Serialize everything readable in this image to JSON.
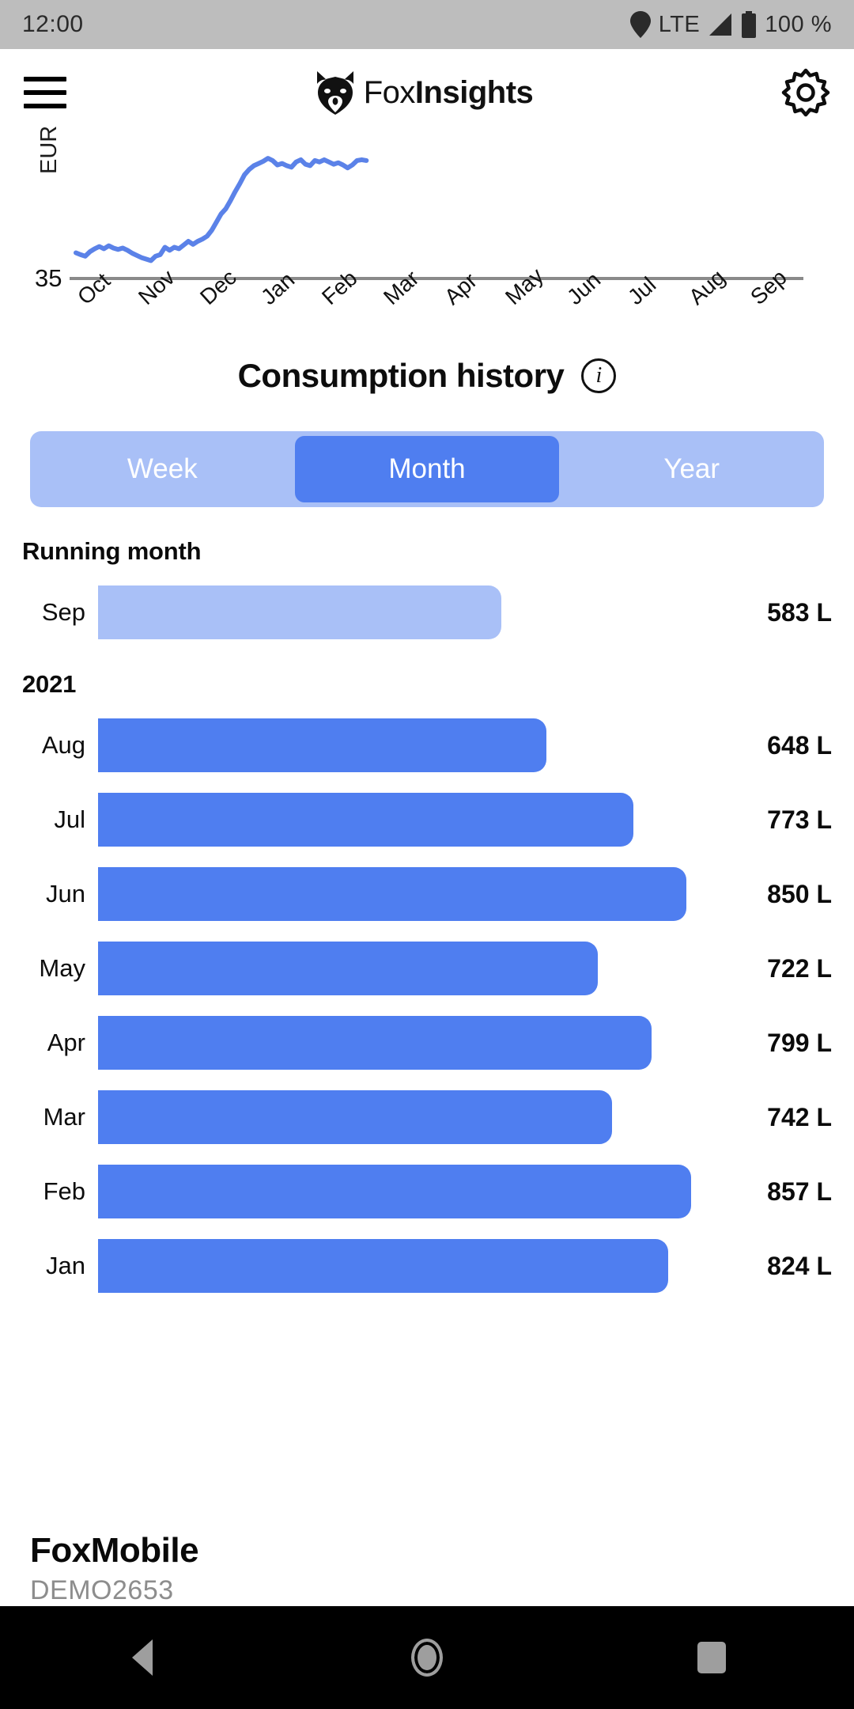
{
  "status_bar": {
    "time": "12:00",
    "network": "LTE",
    "battery_percent": "100 %",
    "icons": [
      "location-icon",
      "signal-icon",
      "battery-icon"
    ]
  },
  "header": {
    "menu_icon": "hamburger-menu-icon",
    "brand_prefix": "Fox",
    "brand_suffix": "Insights",
    "logo_icon": "fox-head-logo",
    "settings_icon": "gear-icon"
  },
  "price_chart": {
    "ylabel": "EUR",
    "ymin_label": "35",
    "line_color": "#5b82e8",
    "axis_color": "#8a8a8a",
    "xticks": [
      "Oct",
      "Nov",
      "Dec",
      "Jan",
      "Feb",
      "Mar",
      "Apr",
      "May",
      "Jun",
      "Jul",
      "Aug",
      "Sep"
    ]
  },
  "chart_data": [
    {
      "type": "line",
      "title": "EUR price history",
      "xlabel": "",
      "ylabel": "EUR",
      "ylim": [
        35,
        70
      ],
      "grid": false,
      "legend": "none",
      "xtick_labels": [
        "Oct",
        "Nov",
        "Dec",
        "Jan",
        "Feb",
        "Mar",
        "Apr",
        "May",
        "Jun",
        "Jul",
        "Aug",
        "Sep"
      ],
      "series": [
        {
          "name": "EUR",
          "color": "#5b82e8",
          "values": [
            41.5,
            41.0,
            40.6,
            41.8,
            42.6,
            43.2,
            42.6,
            43.4,
            42.8,
            42.4,
            42.8,
            42.2,
            41.4,
            40.8,
            40.2,
            39.8,
            39.4,
            40.6,
            41.0,
            43.0,
            42.2,
            43.0,
            42.6,
            43.6,
            44.6,
            43.8,
            44.6,
            45.2,
            46.0,
            47.6,
            49.8,
            52.0,
            53.4,
            55.6,
            58.0,
            60.2,
            62.6,
            64.0,
            65.0,
            65.6,
            66.2,
            67.0,
            66.4,
            65.2,
            65.6,
            65.0,
            64.6,
            66.0,
            66.6,
            65.4,
            65.0,
            66.4,
            66.0,
            66.6,
            66.0,
            65.4,
            65.8,
            65.2,
            64.4,
            65.2,
            66.4,
            66.6,
            66.4
          ]
        }
      ],
      "annotations": [
        "Data ends in February; remaining months Mar–Sep are empty"
      ]
    },
    {
      "type": "bar",
      "orientation": "horizontal",
      "title": "Consumption history",
      "unit": "L",
      "xlabel": "",
      "ylabel": "",
      "groups": [
        {
          "label": "Running month",
          "categories": [
            "Sep"
          ],
          "values": [
            583
          ],
          "color": "#a9c0f7"
        },
        {
          "label": "2021",
          "categories": [
            "Aug",
            "Jul",
            "Jun",
            "May",
            "Apr",
            "Mar",
            "Feb",
            "Jan"
          ],
          "values": [
            648,
            773,
            850,
            722,
            799,
            742,
            857,
            824
          ],
          "color": "#4f7ef0"
        }
      ],
      "max_value": 900
    }
  ],
  "consumption": {
    "title": "Consumption history",
    "info_icon": "info-circle-icon",
    "info_glyph": "i",
    "range_tabs": [
      {
        "label": "Week",
        "active": false
      },
      {
        "label": "Month",
        "active": true
      },
      {
        "label": "Year",
        "active": false
      }
    ],
    "track_color": "#a9c0f7",
    "active_color": "#4f7ef0",
    "groups": [
      {
        "label": "Running month",
        "bar_color": "#a9c0f7",
        "rows": [
          {
            "month": "Sep",
            "value": 583,
            "value_label": "583 L"
          }
        ]
      },
      {
        "label": "2021",
        "bar_color": "#4f7ef0",
        "rows": [
          {
            "month": "Aug",
            "value": 648,
            "value_label": "648 L"
          },
          {
            "month": "Jul",
            "value": 773,
            "value_label": "773 L"
          },
          {
            "month": "Jun",
            "value": 850,
            "value_label": "850 L"
          },
          {
            "month": "May",
            "value": 722,
            "value_label": "722 L"
          },
          {
            "month": "Apr",
            "value": 799,
            "value_label": "799 L"
          },
          {
            "month": "Mar",
            "value": 742,
            "value_label": "742 L"
          },
          {
            "month": "Feb",
            "value": 857,
            "value_label": "857 L"
          },
          {
            "month": "Jan",
            "value": 824,
            "value_label": "824 L"
          }
        ]
      }
    ]
  },
  "footer": {
    "device_name": "FoxMobile",
    "device_id": "DEMO2653"
  },
  "nav_bar": {
    "back_icon": "back-triangle-icon",
    "home_icon": "home-circle-icon",
    "recents_icon": "recents-square-icon"
  }
}
